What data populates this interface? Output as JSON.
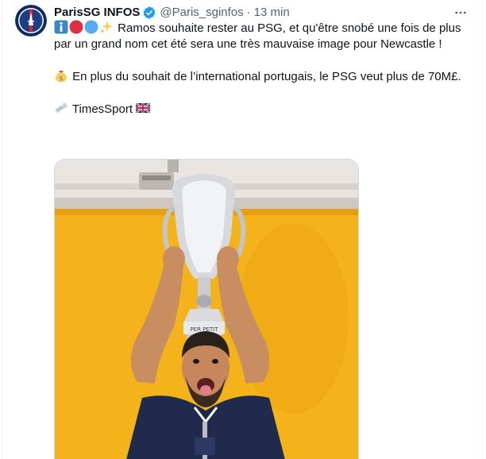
{
  "author": {
    "name": "ParisSG INFOS",
    "handle": "@Paris_sginfos",
    "separator": "·",
    "time": "13 min",
    "verified": true
  },
  "tweet": {
    "line1_emojis": [
      "info-icon",
      "red-circle-icon",
      "blue-circle-icon",
      "sparkles-icon"
    ],
    "paragraph1": "Ramos souhaite rester au PSG, et qu'être snobé une fois de plus par un grand nom cet été sera une très mauvaise image pour Newcastle !",
    "paragraph2_emoji": "money-bag-icon",
    "paragraph2": "En plus du souhait de l’international portugais, le PSG veut plus de 70M£.",
    "source_emoji": "newspaper-icon",
    "source": "TimesSport",
    "source_flag": "uk-flag-icon"
  },
  "media": {
    "type": "photo",
    "trophy_text": "PER      PETIT"
  },
  "colors": {
    "text": "#0f1419",
    "secondary": "#536471",
    "verified": "#1d9bf0",
    "background": "#ffffff",
    "photo_wall": "#f5b31b"
  }
}
